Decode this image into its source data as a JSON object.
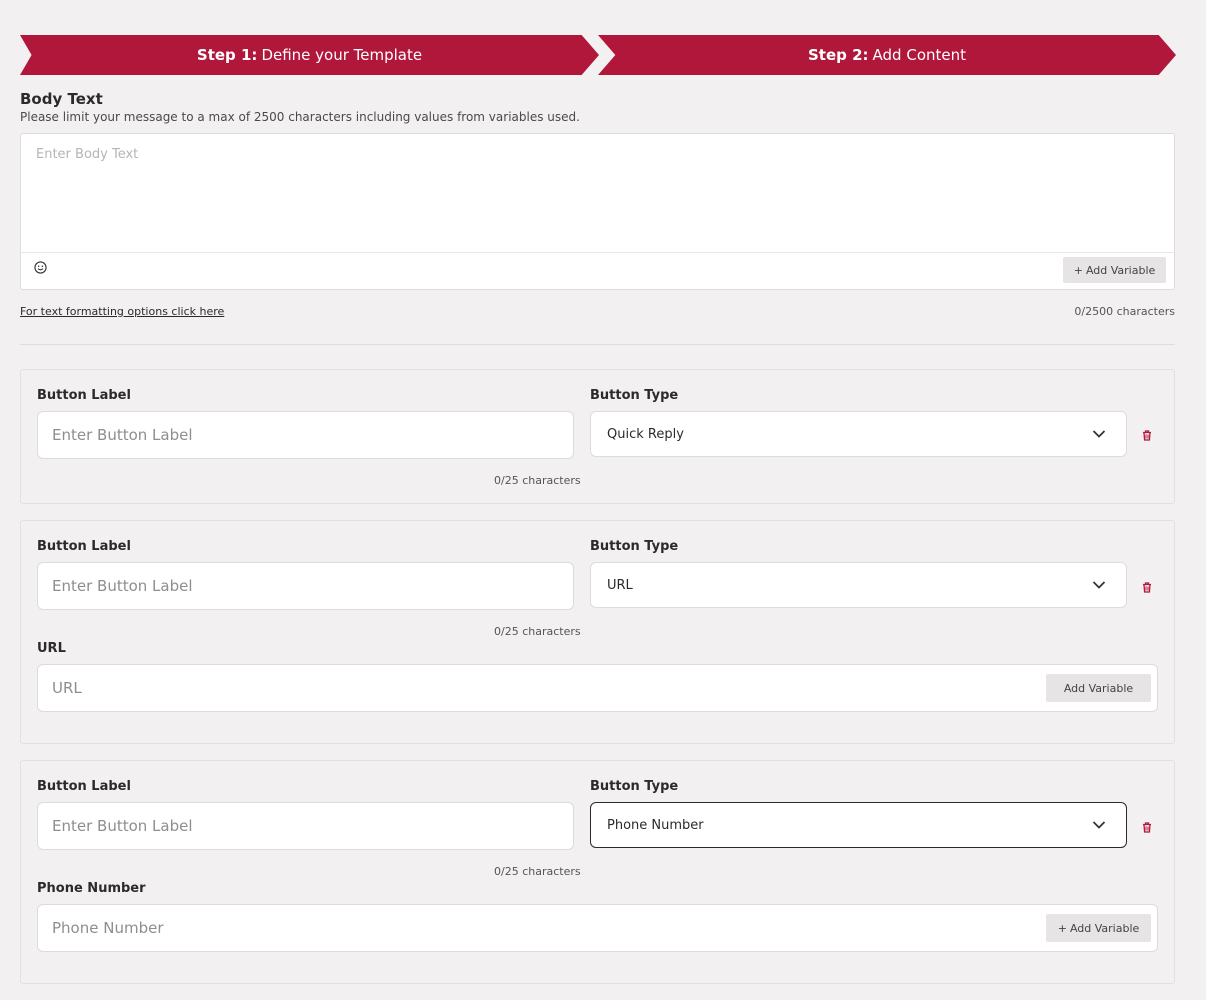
{
  "steps": [
    {
      "prefix": "Step 1:",
      "label": "Define your Template"
    },
    {
      "prefix": "Step 2:",
      "label": "Add Content"
    }
  ],
  "body": {
    "title": "Body Text",
    "description": "Please limit your message to a max of 2500 characters including values from variables used.",
    "placeholder": "Enter Body Text",
    "add_variable": "Add Variable",
    "formatting_link": "For text formatting options click here",
    "char_count": "0/2500 characters"
  },
  "buttons": [
    {
      "label_title": "Button Label",
      "label_placeholder": "Enter Button Label",
      "label_count": "0/25 characters",
      "type_title": "Button Type",
      "type_value": "Quick Reply"
    },
    {
      "label_title": "Button Label",
      "label_placeholder": "Enter Button Label",
      "label_count": "0/25 characters",
      "type_title": "Button Type",
      "type_value": "URL",
      "extra_title": "URL",
      "extra_placeholder": "URL",
      "extra_add_variable": "Add Variable"
    },
    {
      "label_title": "Button Label",
      "label_placeholder": "Enter Button Label",
      "label_count": "0/25 characters",
      "type_title": "Button Type",
      "type_value": "Phone Number",
      "extra_title": "Phone Number",
      "extra_placeholder": "Phone Number",
      "extra_add_variable": "Add Variable"
    }
  ],
  "colors": {
    "accent": "#b0173a",
    "delete": "#b0173a"
  },
  "icons": {
    "emoji": "smiley-icon",
    "dropdown": "chevron-down-icon",
    "delete": "trash-icon",
    "add": "plus-icon"
  }
}
